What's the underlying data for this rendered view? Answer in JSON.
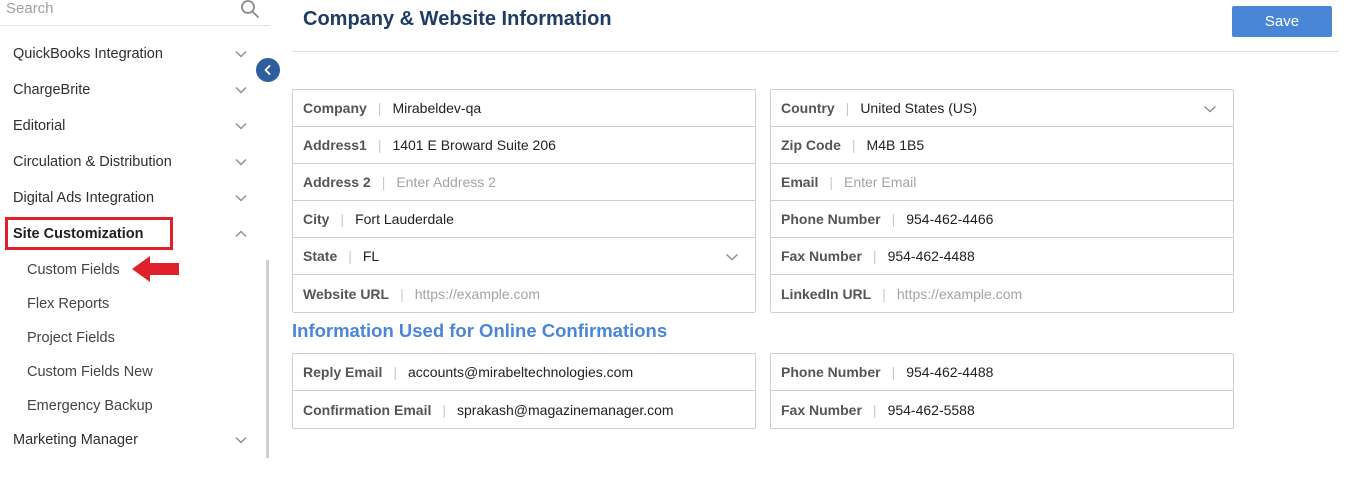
{
  "sidebar": {
    "search_placeholder": "Search",
    "items": [
      {
        "label": "QuickBooks Integration"
      },
      {
        "label": "ChargeBrite"
      },
      {
        "label": "Editorial"
      },
      {
        "label": "Circulation & Distribution"
      },
      {
        "label": "Digital Ads Integration"
      },
      {
        "label": "Site Customization",
        "active": true
      },
      {
        "label": "Marketing Manager"
      }
    ],
    "sub_items": [
      {
        "label": "Custom Fields"
      },
      {
        "label": "Flex Reports"
      },
      {
        "label": "Project Fields"
      },
      {
        "label": "Custom Fields New"
      },
      {
        "label": "Emergency Backup"
      }
    ]
  },
  "header": {
    "title": "Company & Website Information",
    "save_label": "Save"
  },
  "company_info": {
    "left": [
      {
        "label": "Company",
        "value": "Mirabeldev-qa"
      },
      {
        "label": "Address1",
        "value": "1401 E Broward Suite 206"
      },
      {
        "label": "Address 2",
        "value": "",
        "placeholder": "Enter Address 2"
      },
      {
        "label": "City",
        "value": "Fort Lauderdale"
      },
      {
        "label": "State",
        "value": "FL",
        "dropdown": true
      },
      {
        "label": "Website URL",
        "value": "",
        "placeholder": "https://example.com"
      }
    ],
    "right": [
      {
        "label": "Country",
        "value": "United States (US)",
        "dropdown": true
      },
      {
        "label": "Zip Code",
        "value": "M4B 1B5"
      },
      {
        "label": "Email",
        "value": "",
        "placeholder": "Enter Email"
      },
      {
        "label": "Phone Number",
        "value": "954-462-4466"
      },
      {
        "label": "Fax Number",
        "value": "954-462-4488"
      },
      {
        "label": "LinkedIn URL",
        "value": "",
        "placeholder": "https://example.com"
      }
    ]
  },
  "confirmations": {
    "heading": "Information Used for Online Confirmations",
    "left": [
      {
        "label": "Reply Email",
        "value": "accounts@mirabeltechnologies.com"
      },
      {
        "label": "Confirmation Email",
        "value": "sprakash@magazinemanager.com"
      }
    ],
    "right": [
      {
        "label": "Phone Number",
        "value": "954-462-4488"
      },
      {
        "label": "Fax Number",
        "value": "954-462-5588"
      }
    ]
  },
  "colors": {
    "accent": "#4a86d8",
    "title": "#1f3c66",
    "annotation_red": "#e0202a",
    "collapse_button": "#2d5f9e"
  },
  "icons": {
    "search": "search-icon",
    "chevron": "chevron-down-icon",
    "collapse": "chevron-left-icon"
  }
}
